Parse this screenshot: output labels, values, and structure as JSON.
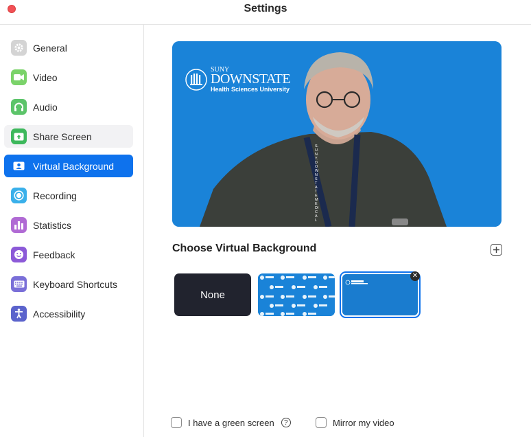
{
  "window": {
    "title": "Settings"
  },
  "sidebar": {
    "items": [
      {
        "label": "General",
        "icon": "gear-icon",
        "color": "#d0d0d0"
      },
      {
        "label": "Video",
        "icon": "video-icon",
        "color": "#7bd36a"
      },
      {
        "label": "Audio",
        "icon": "headphones-icon",
        "color": "#5cc46a"
      },
      {
        "label": "Share Screen",
        "icon": "share-screen-icon",
        "color": "#3eb85c"
      },
      {
        "label": "Virtual Background",
        "icon": "person-icon",
        "color": "#0e72ed"
      },
      {
        "label": "Recording",
        "icon": "record-icon",
        "color": "#3ab0ea"
      },
      {
        "label": "Statistics",
        "icon": "bar-chart-icon",
        "color": "#b06ad4"
      },
      {
        "label": "Feedback",
        "icon": "smiley-icon",
        "color": "#8c5ad8"
      },
      {
        "label": "Keyboard Shortcuts",
        "icon": "keyboard-icon",
        "color": "#7a6fd8"
      },
      {
        "label": "Accessibility",
        "icon": "accessibility-icon",
        "color": "#5b63cc"
      }
    ],
    "active_index": 4,
    "hover_index": 3
  },
  "preview": {
    "logo_top": "SUNY",
    "logo_main": "DOWNSTATE",
    "logo_sub": "Health Sciences University",
    "lanyard_text": "S.U.N.Y. DOWNSTATE MEDICAL",
    "background_color": "#1a83d8"
  },
  "virtual_background": {
    "heading": "Choose Virtual Background",
    "add_icon": "plus-icon",
    "thumbnails": [
      {
        "label": "None"
      },
      {
        "label": "",
        "type": "pattern"
      },
      {
        "label": "",
        "type": "logo",
        "selected": true
      }
    ]
  },
  "options": {
    "green_screen_label": "I have a green screen",
    "mirror_label": "Mirror my video",
    "green_screen_checked": false,
    "mirror_checked": false
  }
}
